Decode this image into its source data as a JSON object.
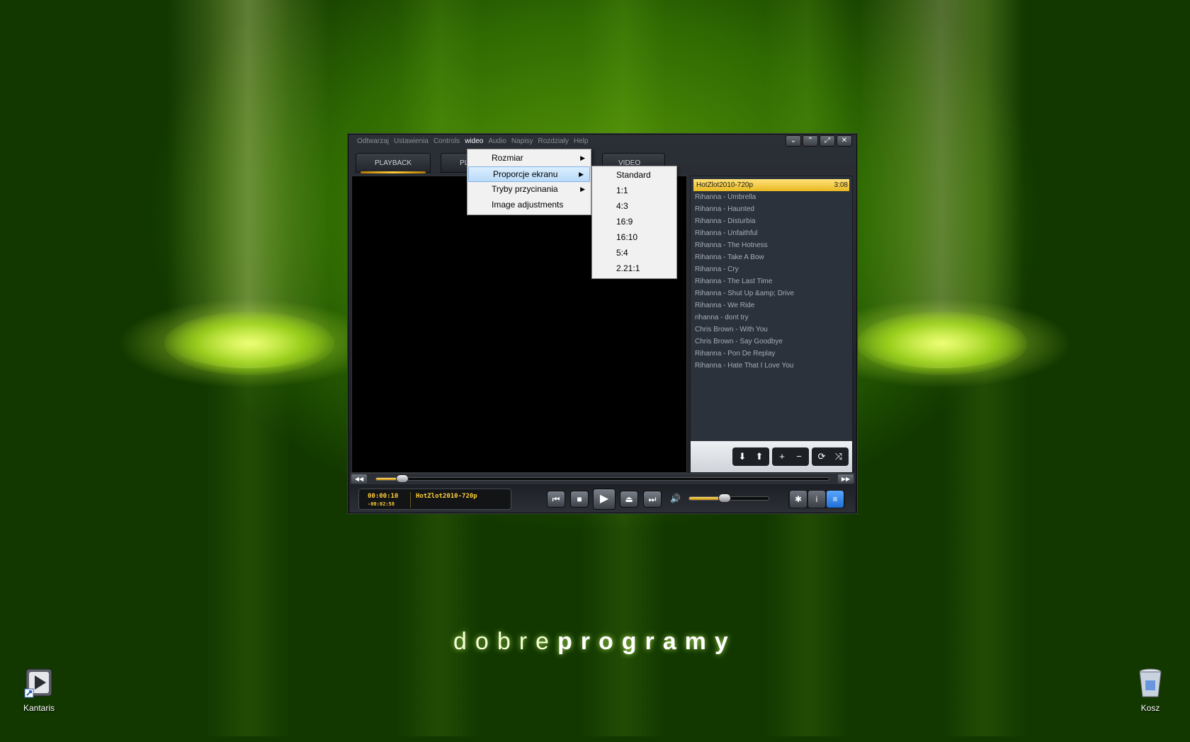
{
  "brand": {
    "light": "dobre",
    "bold": "programy"
  },
  "desktop": [
    {
      "label": "Kantaris",
      "icon": "kantaris-shortcut-icon"
    },
    {
      "label": "Kosz",
      "icon": "recycle-bin-icon"
    }
  ],
  "player": {
    "menubar": [
      "Odtwarzaj",
      "Ustawienia",
      "Controls",
      "wideo",
      "Audio",
      "Napisy",
      "Rozdziały",
      "Help"
    ],
    "window_buttons": {
      "minimize": "⌄",
      "restore": "⌃",
      "resize": "⤢",
      "close": "✕"
    },
    "tabs": {
      "playback": "PLAYBACK",
      "playlist": "PLAYLIST",
      "video_library": "VIDEO LIBRARY"
    },
    "playlist": {
      "selected": {
        "title": "HotZlot2010-720p",
        "duration": "3:08"
      },
      "items": [
        "Rihanna - Umbrella",
        "Rihanna - Haunted",
        "Rihanna - Disturbia",
        "Rihanna - Unfaithful",
        "Rihanna - The Hotness",
        "Rihanna - Take A Bow",
        "Rihanna - Cry",
        "Rihanna - The Last Time",
        "Rihanna - Shut Up &amp; Drive",
        "Rihanna - We Ride",
        "rihanna - dont try",
        "Chris Brown - With You",
        "Chris Brown - Say Goodbye",
        "Rihanna - Pon De Replay",
        "Rihanna - Hate That I Love You"
      ],
      "tools": {
        "move_down": "⬇",
        "move_up": "⬆",
        "add": "+",
        "remove": "−",
        "repeat": "⟳",
        "shuffle": "⤨"
      }
    },
    "lcd": {
      "elapsed": "00:00:10",
      "remaining": "-00:02:58",
      "title": "HotZlot2010-720p"
    },
    "seek_progress": 0.05,
    "volume_level": 0.45,
    "transport": {
      "prev": "⏮",
      "stop": "■",
      "play": "▶",
      "eject": "⏏",
      "next": "⏭",
      "rewind": "◀◀",
      "forward": "▶▶",
      "volume": "🔊"
    },
    "right_buttons": {
      "settings": "✱",
      "info": "i",
      "playlist": "≡"
    }
  },
  "menu_main": {
    "items": [
      {
        "label": "Rozmiar",
        "submenu": "▶"
      },
      {
        "label": "Proporcje ekranu",
        "submenu": "▶"
      },
      {
        "label": "Tryby przycinania",
        "submenu": "▶"
      },
      {
        "label": "Image adjustments",
        "submenu": ""
      }
    ]
  },
  "menu_sub": {
    "items": [
      "Standard",
      "1:1",
      "4:3",
      "16:9",
      "16:10",
      "5:4",
      "2.21:1"
    ]
  },
  "colors": {
    "accent": "#ffcc33",
    "menu_highlight": "#b9dbf8",
    "window_bg": "#2b2f36"
  }
}
